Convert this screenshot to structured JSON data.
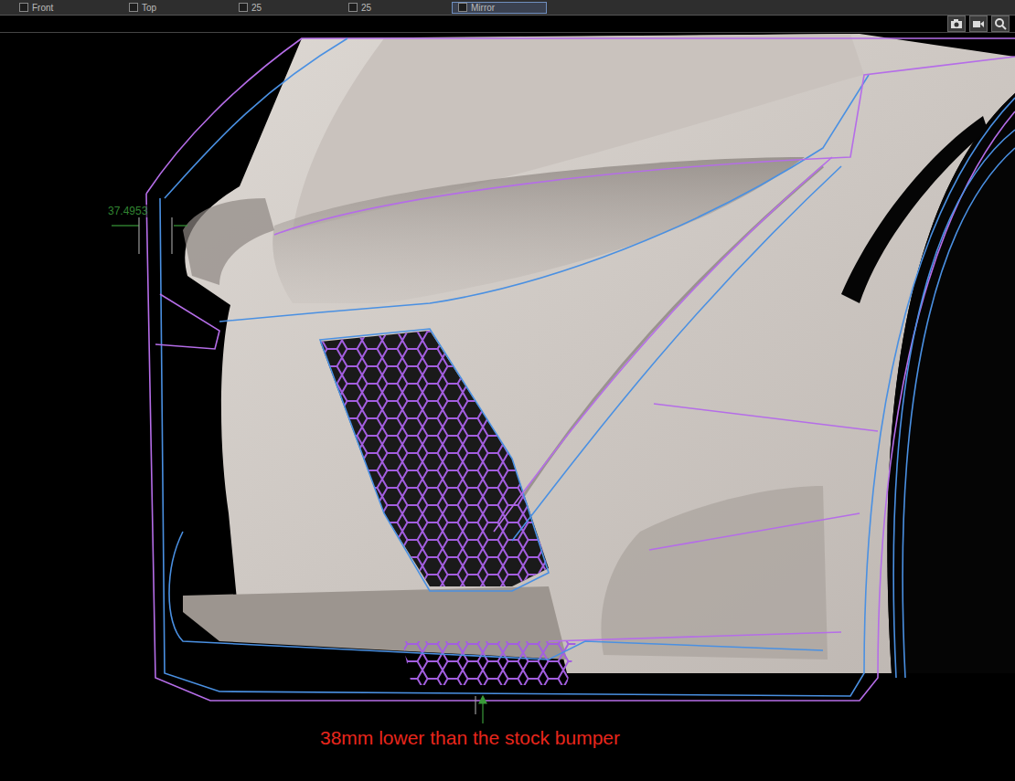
{
  "toolbar": {
    "items": [
      {
        "label": "Front",
        "selected": false
      },
      {
        "label": "Top",
        "selected": false
      },
      {
        "label": "25",
        "selected": false
      },
      {
        "label": "25",
        "selected": false
      },
      {
        "label": "Mirror",
        "selected": true
      }
    ]
  },
  "measurement": {
    "value": "37.4953",
    "color": "#3a9a3a"
  },
  "annotation": {
    "text": "38mm lower than the stock bumper",
    "color": "#e8261c"
  }
}
